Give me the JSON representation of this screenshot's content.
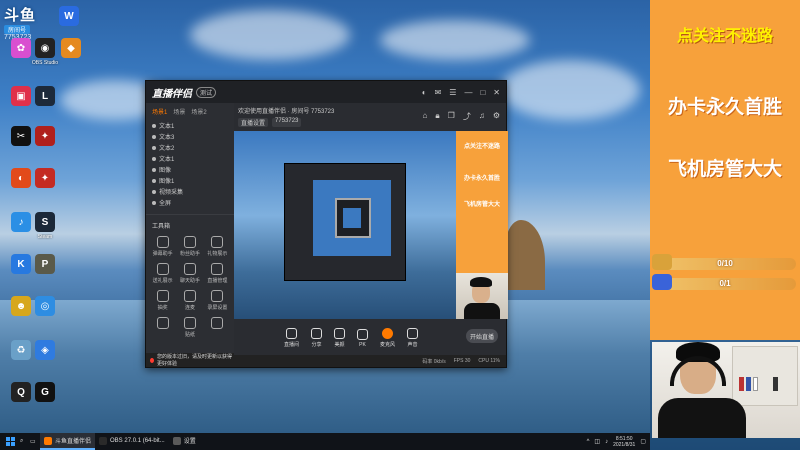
{
  "desktop": {
    "brand": {
      "logo": "斗鱼",
      "room_label": "房间号",
      "room_no": "7753723"
    },
    "icons": [
      {
        "name": "wps-icon",
        "label": "",
        "color": "#2a6be0",
        "glyph": "W"
      },
      {
        "name": "app-icon-colorful",
        "label": "",
        "color": "#d94fd0",
        "glyph": "✿"
      },
      {
        "name": "obs-icon",
        "label": "OBS Studio",
        "color": "#222222",
        "glyph": "◉"
      },
      {
        "name": "app-icon-orange",
        "label": "",
        "color": "#e58a1f",
        "glyph": "◆"
      },
      {
        "name": "cube-app-icon",
        "label": "",
        "color": "#e0304a",
        "glyph": "▣"
      },
      {
        "name": "lol-icon",
        "label": "",
        "color": "#1d2a3a",
        "glyph": "L"
      },
      {
        "name": "capcut-icon",
        "label": "",
        "color": "#111111",
        "glyph": "✂"
      },
      {
        "name": "cf-icon",
        "label": "",
        "color": "#b0201c",
        "glyph": "✦"
      },
      {
        "name": "app-icon-a",
        "label": "",
        "color": "#e24a1a",
        "glyph": "◐"
      },
      {
        "name": "cf-icon-2",
        "label": "",
        "color": "#c42b23",
        "glyph": "✦"
      },
      {
        "name": "qqmusic-icon",
        "label": "",
        "color": "#2b8fe5",
        "glyph": "♪"
      },
      {
        "name": "steam-icon",
        "label": "Steam",
        "color": "#1b2838",
        "glyph": "S"
      },
      {
        "name": "kuaishou-icon",
        "label": "",
        "color": "#2779e0",
        "glyph": "K"
      },
      {
        "name": "pubg-icon",
        "label": "",
        "color": "#5a5a4a",
        "glyph": "P"
      },
      {
        "name": "game-icon-yellow",
        "label": "",
        "color": "#d7a71c",
        "glyph": "☻"
      },
      {
        "name": "game-icon-blue",
        "label": "",
        "color": "#2e8de2",
        "glyph": "◎"
      },
      {
        "name": "recycle-bin-icon",
        "label": "",
        "color": "#6aa0c8",
        "glyph": "♻"
      },
      {
        "name": "shield-app-icon",
        "label": "",
        "color": "#2f7be0",
        "glyph": "◈"
      },
      {
        "name": "qq-icon",
        "label": "",
        "color": "#222222",
        "glyph": "Q"
      },
      {
        "name": "garena-icon",
        "label": "",
        "color": "#111111",
        "glyph": "G"
      }
    ]
  },
  "window": {
    "title": "直播伴侣",
    "tag": "测试",
    "side_tabs": [
      "场景1",
      "场景",
      "场景2"
    ],
    "sources": [
      "文本1",
      "文本3",
      "文本2",
      "文本1",
      "图像",
      "图像1",
      "视频采集",
      "全屏"
    ],
    "tools_title": "工具箱",
    "tools": [
      "弹幕助手",
      "粉丝助手",
      "礼物展示",
      "送礼展示",
      "聊天助手",
      "直播管理",
      "抽奖",
      "连麦",
      "录屏设置",
      "",
      "贴纸",
      ""
    ],
    "head_line1": "欢迎使用直播伴侣 · 房间号 7753723",
    "head_chips": [
      "直播设置",
      "7753723"
    ],
    "overlay_preview": {
      "line1": "点关注不迷路",
      "line2": "办卡永久首胜",
      "line3": "飞机房管大大"
    },
    "bottom_items": [
      "直播间",
      "分享",
      "美颜",
      "PK",
      "麦克风",
      "声音"
    ],
    "start_button": "开始直播",
    "notice": "您的版本过旧，请及时更新以获得更好体验",
    "status": [
      "码率 0kb/s",
      "FPS 30",
      "CPU 11%"
    ]
  },
  "overlay": {
    "line1": "点关注不迷路",
    "line2": "办卡永久首胜",
    "line3": "飞机房管大大",
    "progress": [
      {
        "label": "0/10",
        "fraction": 0.0,
        "icon_color": "#d9a23a"
      },
      {
        "label": "0/1",
        "fraction": 0.0,
        "icon_color": "#3a63d9"
      }
    ]
  },
  "taskbar": {
    "tasks": [
      {
        "label": "斗鱼直播伴侣",
        "color": "#ff7a00",
        "active": true
      },
      {
        "label": "OBS 27.0.1 (64-bit...",
        "color": "#2a2a2a",
        "active": false
      },
      {
        "label": "设置",
        "color": "#5a5a5a",
        "active": false
      }
    ],
    "time": "8:51:50",
    "date": "2021/8/31"
  }
}
